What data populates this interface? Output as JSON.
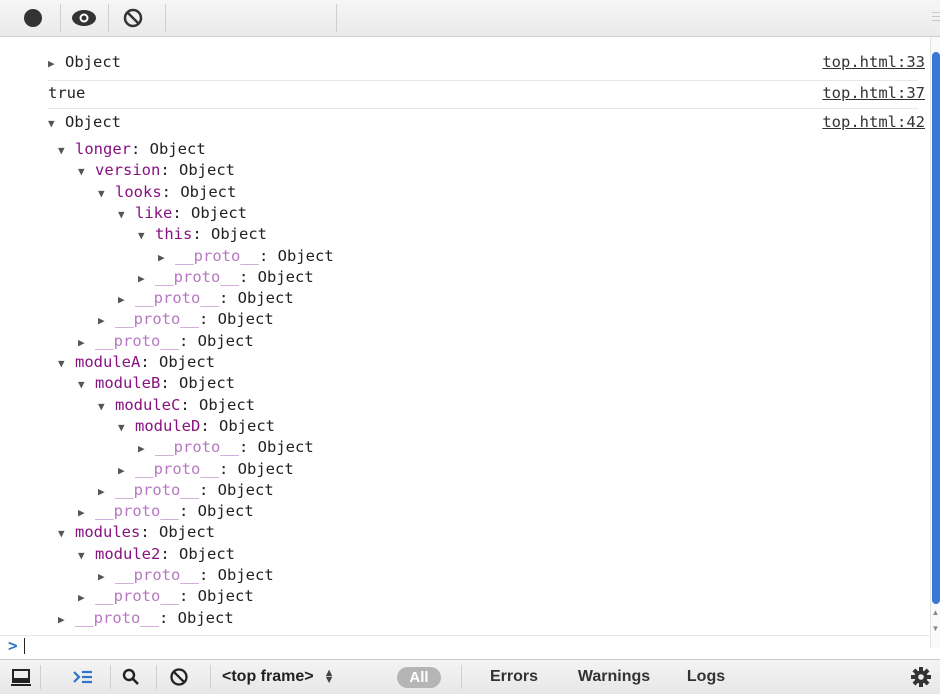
{
  "toolbar": {
    "buttons": [
      {
        "icon": "record-icon"
      },
      {
        "icon": "eye-icon"
      },
      {
        "icon": "clear-icon"
      }
    ]
  },
  "console": {
    "messages": [
      {
        "text": "Object",
        "expanded": false,
        "source": "top.html:33"
      },
      {
        "text": "true",
        "source": "top.html:37"
      },
      {
        "text": "Object",
        "expanded": true,
        "source": "top.html:42"
      }
    ],
    "tree": [
      {
        "depth": 1,
        "key": "longer",
        "value": "Object",
        "expanded": true,
        "proto": false
      },
      {
        "depth": 2,
        "key": "version",
        "value": "Object",
        "expanded": true,
        "proto": false
      },
      {
        "depth": 3,
        "key": "looks",
        "value": "Object",
        "expanded": true,
        "proto": false
      },
      {
        "depth": 4,
        "key": "like",
        "value": "Object",
        "expanded": true,
        "proto": false
      },
      {
        "depth": 5,
        "key": "this",
        "value": "Object",
        "expanded": true,
        "proto": false
      },
      {
        "depth": 6,
        "key": "__proto__",
        "value": "Object",
        "expanded": false,
        "proto": true
      },
      {
        "depth": 5,
        "key": "__proto__",
        "value": "Object",
        "expanded": false,
        "proto": true
      },
      {
        "depth": 4,
        "key": "__proto__",
        "value": "Object",
        "expanded": false,
        "proto": true
      },
      {
        "depth": 3,
        "key": "__proto__",
        "value": "Object",
        "expanded": false,
        "proto": true
      },
      {
        "depth": 2,
        "key": "__proto__",
        "value": "Object",
        "expanded": false,
        "proto": true
      },
      {
        "depth": 1,
        "key": "moduleA",
        "value": "Object",
        "expanded": true,
        "proto": false
      },
      {
        "depth": 2,
        "key": "moduleB",
        "value": "Object",
        "expanded": true,
        "proto": false
      },
      {
        "depth": 3,
        "key": "moduleC",
        "value": "Object",
        "expanded": true,
        "proto": false
      },
      {
        "depth": 4,
        "key": "moduleD",
        "value": "Object",
        "expanded": true,
        "proto": false
      },
      {
        "depth": 5,
        "key": "__proto__",
        "value": "Object",
        "expanded": false,
        "proto": true
      },
      {
        "depth": 4,
        "key": "__proto__",
        "value": "Object",
        "expanded": false,
        "proto": true
      },
      {
        "depth": 3,
        "key": "__proto__",
        "value": "Object",
        "expanded": false,
        "proto": true
      },
      {
        "depth": 2,
        "key": "__proto__",
        "value": "Object",
        "expanded": false,
        "proto": true
      },
      {
        "depth": 1,
        "key": "modules",
        "value": "Object",
        "expanded": true,
        "proto": false
      },
      {
        "depth": 2,
        "key": "module2",
        "value": "Object",
        "expanded": true,
        "proto": false
      },
      {
        "depth": 3,
        "key": "__proto__",
        "value": "Object",
        "expanded": false,
        "proto": true
      },
      {
        "depth": 2,
        "key": "__proto__",
        "value": "Object",
        "expanded": false,
        "proto": true
      },
      {
        "depth": 1,
        "key": "__proto__",
        "value": "Object",
        "expanded": false,
        "proto": true
      }
    ],
    "prompt": ">"
  },
  "bottombar": {
    "frame_select": "<top frame>",
    "filters": {
      "all": "All",
      "errors": "Errors",
      "warnings": "Warnings",
      "logs": "Logs"
    }
  },
  "colors": {
    "key": "#881280",
    "proto": "#b777c2",
    "prompt": "#2f74c9",
    "scroll": "#3a78d6"
  }
}
